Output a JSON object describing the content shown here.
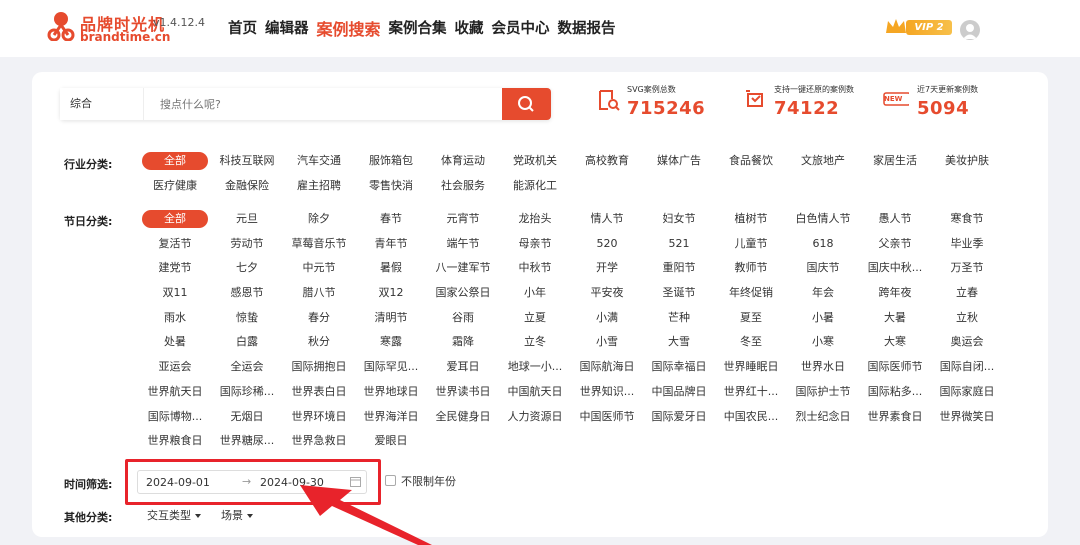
{
  "header": {
    "brand_name": "品牌时光机",
    "version": "v1.4.12.4",
    "domain": "brandtime.cn",
    "nav": [
      "首页",
      "编辑器",
      "案例搜索",
      "案例合集",
      "收藏",
      "会员中心",
      "数据报告"
    ],
    "active_nav": "案例搜索",
    "vip_label": "VIP 2"
  },
  "search": {
    "type": "综合",
    "placeholder": "搜点什么呢?"
  },
  "stats": [
    {
      "label": "SVG案例总数",
      "value": "715246"
    },
    {
      "label": "支持一键还原的案例数",
      "value": "74122"
    },
    {
      "label": "近7天更新案例数",
      "value": "5094"
    }
  ],
  "new_badge": "NEW",
  "industry": {
    "label": "行业分类:",
    "tags": [
      "全部",
      "科技互联网",
      "汽车交通",
      "服饰箱包",
      "体育运动",
      "党政机关",
      "高校教育",
      "媒体广告",
      "食品餐饮",
      "文旅地产",
      "家居生活",
      "美妆护肤",
      "医疗健康",
      "金融保险",
      "雇主招聘",
      "零售快消",
      "社会服务",
      "能源化工"
    ]
  },
  "festival": {
    "label": "节日分类:",
    "tags": [
      "全部",
      "元旦",
      "除夕",
      "春节",
      "元宵节",
      "龙抬头",
      "情人节",
      "妇女节",
      "植树节",
      "白色情人节",
      "愚人节",
      "寒食节",
      "复活节",
      "劳动节",
      "草莓音乐节",
      "青年节",
      "端午节",
      "母亲节",
      "520",
      "521",
      "儿童节",
      "618",
      "父亲节",
      "毕业季",
      "建党节",
      "七夕",
      "中元节",
      "暑假",
      "八一建军节",
      "中秋节",
      "开学",
      "重阳节",
      "教师节",
      "国庆节",
      "国庆中秋...",
      "万圣节",
      "双11",
      "感恩节",
      "腊八节",
      "双12",
      "国家公祭日",
      "小年",
      "平安夜",
      "圣诞节",
      "年终促销",
      "年会",
      "跨年夜",
      "立春",
      "雨水",
      "惊蛰",
      "春分",
      "清明节",
      "谷雨",
      "立夏",
      "小满",
      "芒种",
      "夏至",
      "小暑",
      "大暑",
      "立秋",
      "处暑",
      "白露",
      "秋分",
      "寒露",
      "霜降",
      "立冬",
      "小雪",
      "大雪",
      "冬至",
      "小寒",
      "大寒",
      "奥运会",
      "亚运会",
      "全运会",
      "国际拥抱日",
      "国际罕见...",
      "爱耳日",
      "地球一小...",
      "国际航海日",
      "国际幸福日",
      "世界睡眠日",
      "世界水日",
      "国际医师节",
      "国际自闭...",
      "世界航天日",
      "国际珍稀...",
      "世界表白日",
      "世界地球日",
      "世界读书日",
      "中国航天日",
      "世界知识...",
      "中国品牌日",
      "世界红十...",
      "国际护士节",
      "国际粘多...",
      "国际家庭日",
      "国际博物...",
      "无烟日",
      "世界环境日",
      "世界海洋日",
      "全民健身日",
      "人力资源日",
      "中国医师节",
      "国际爱牙日",
      "中国农民...",
      "烈士纪念日",
      "世界素食日",
      "世界微笑日",
      "世界粮食日",
      "世界糖尿...",
      "世界急救日",
      "爱眼日"
    ]
  },
  "time_filter": {
    "label": "时间筛选:",
    "start": "2024-09-01",
    "arrow": "→",
    "end": "2024-09-30",
    "no_limit_label": "不限制年份"
  },
  "other": {
    "label": "其他分类:",
    "interaction": "交互类型",
    "scene": "场景"
  },
  "colors": {
    "accent": "#e64b2e",
    "annotation": "#e8232b"
  }
}
